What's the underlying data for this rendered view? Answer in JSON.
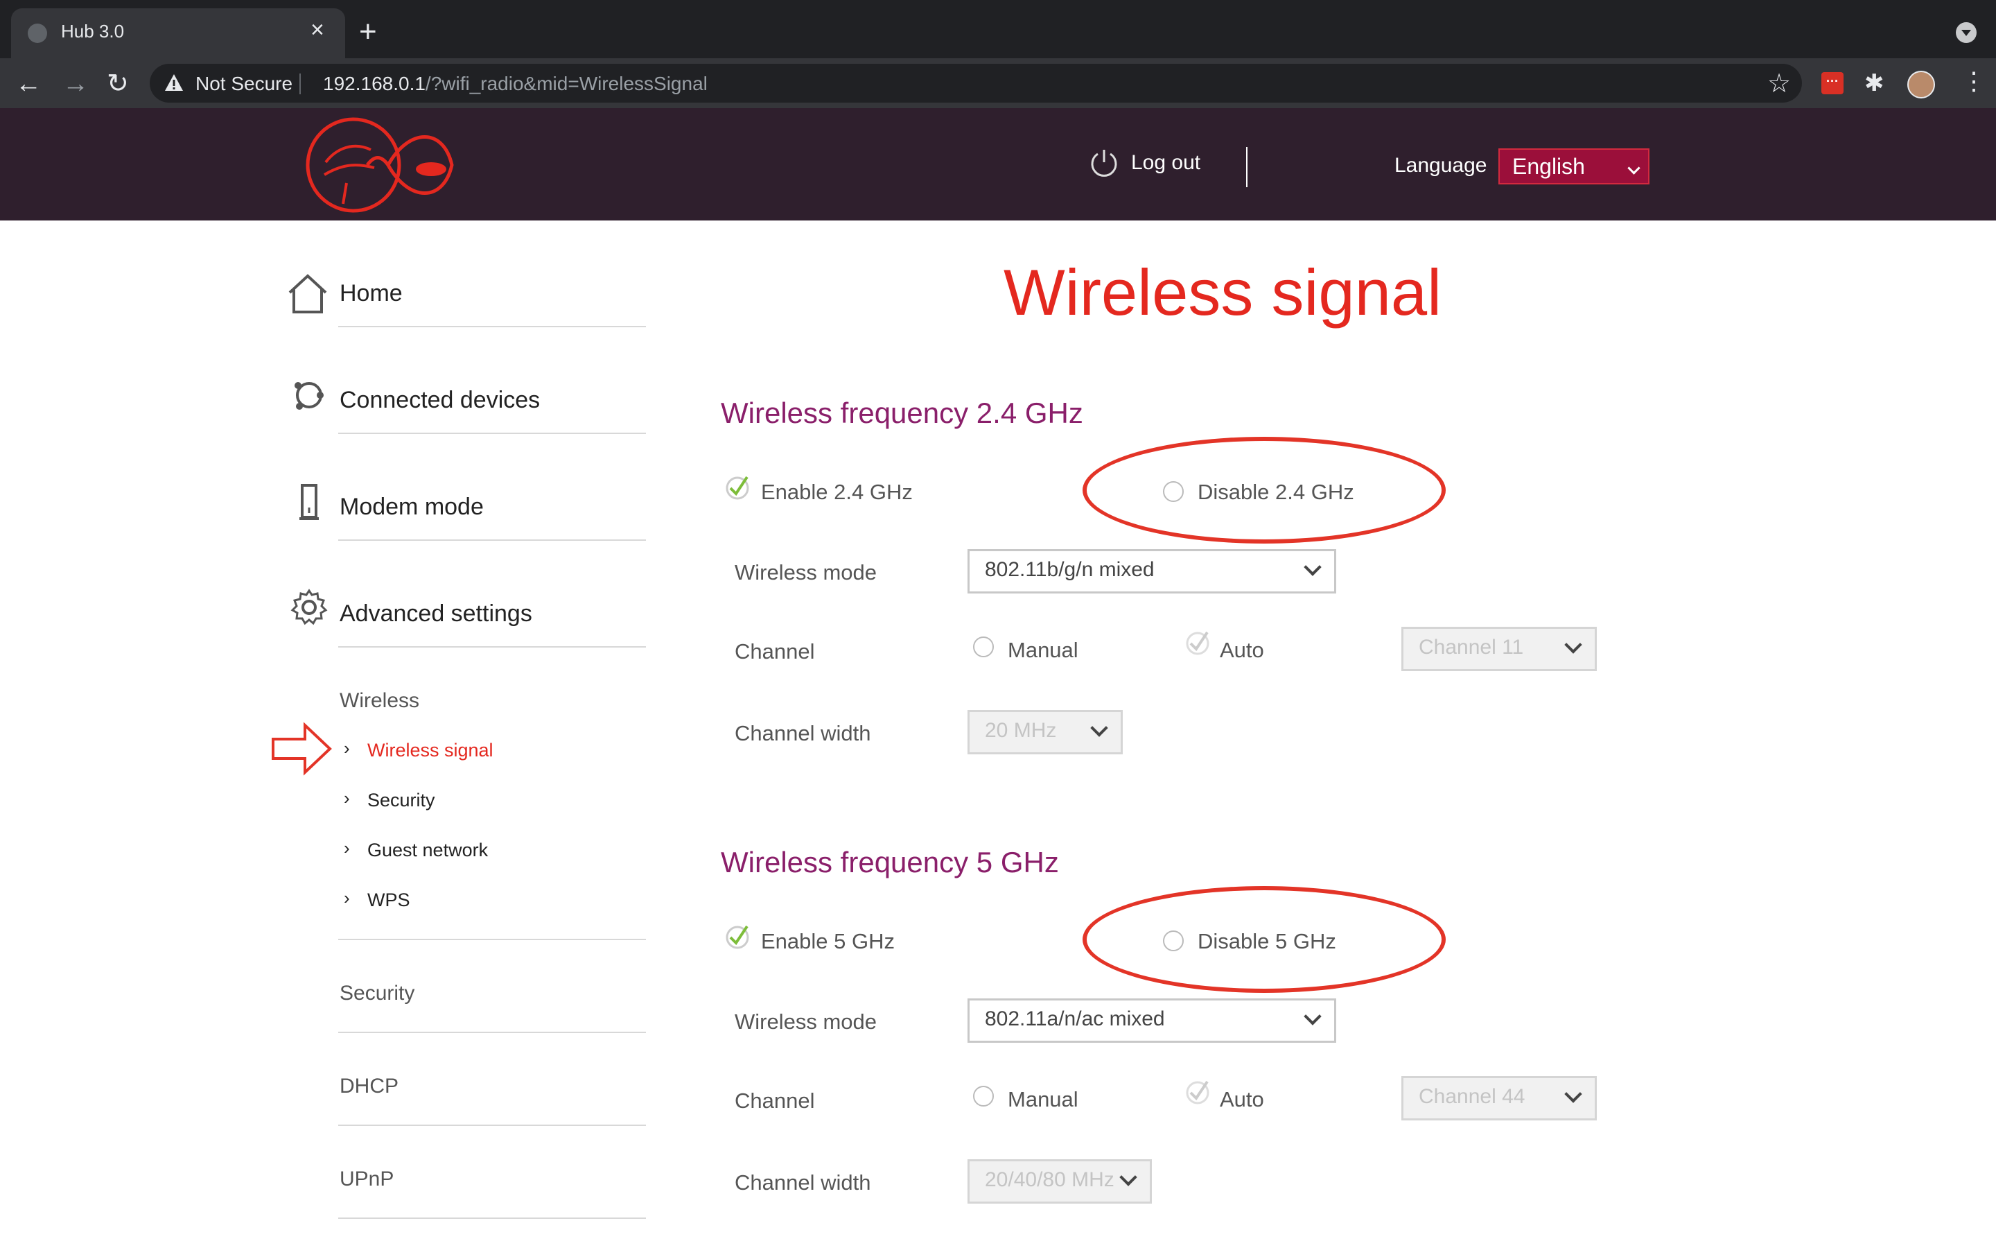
{
  "browser": {
    "tab_title": "Hub 3.0",
    "security_label": "Not Secure",
    "url_host": "192.168.0.1",
    "url_path": "/?wifi_radio&mid=WirelessSignal"
  },
  "header": {
    "logout_label": "Log out",
    "language_label": "Language",
    "language_value": "English"
  },
  "sidebar": {
    "items": [
      {
        "label": "Home"
      },
      {
        "label": "Connected devices"
      },
      {
        "label": "Modem mode"
      },
      {
        "label": "Advanced settings"
      }
    ],
    "wireless_heading": "Wireless",
    "wireless_subitems": [
      {
        "label": "Wireless signal"
      },
      {
        "label": "Security"
      },
      {
        "label": "Guest network"
      },
      {
        "label": "WPS"
      }
    ],
    "more_sections": [
      {
        "label": "Security"
      },
      {
        "label": "DHCP"
      },
      {
        "label": "UPnP"
      }
    ]
  },
  "main": {
    "title": "Wireless signal",
    "band24": {
      "title": "Wireless frequency 2.4 GHz",
      "enable_label": "Enable 2.4 GHz",
      "disable_label": "Disable 2.4 GHz",
      "mode_label": "Wireless mode",
      "mode_value": "802.11b/g/n mixed",
      "channel_label": "Channel",
      "manual_label": "Manual",
      "auto_label": "Auto",
      "channel_value": "Channel 11",
      "width_label": "Channel width",
      "width_value": "20 MHz"
    },
    "band5": {
      "title": "Wireless frequency 5 GHz",
      "enable_label": "Enable 5 GHz",
      "disable_label": "Disable 5 GHz",
      "mode_label": "Wireless mode",
      "mode_value": "802.11a/n/ac mixed",
      "channel_label": "Channel",
      "manual_label": "Manual",
      "auto_label": "Auto",
      "channel_value": "Channel 44",
      "width_label": "Channel width",
      "width_value": "20/40/80 MHz"
    }
  },
  "colors": {
    "accent_red": "#e4281f",
    "section_purple": "#8a1f6a",
    "header_bg": "#2f1f2d",
    "annotation_red": "#e33427"
  }
}
